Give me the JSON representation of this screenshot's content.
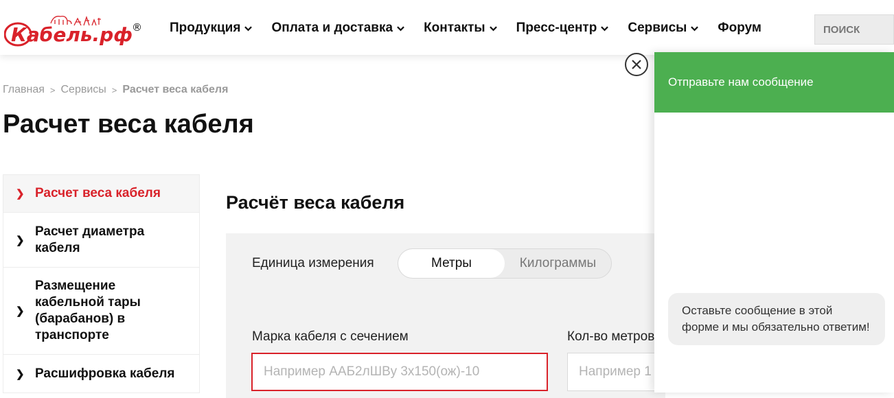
{
  "header": {
    "logo_text": "Кабель.рф",
    "logo_mark": "®",
    "nav": [
      {
        "label": "Продукция",
        "has_dropdown": true
      },
      {
        "label": "Оплата и доставка",
        "has_dropdown": true
      },
      {
        "label": "Контакты",
        "has_dropdown": true
      },
      {
        "label": "Пресс-центр",
        "has_dropdown": true
      },
      {
        "label": "Сервисы",
        "has_dropdown": true
      },
      {
        "label": "Форум",
        "has_dropdown": false
      }
    ],
    "search_placeholder": "ПОИСК"
  },
  "breadcrumb": {
    "items": [
      "Главная",
      "Сервисы"
    ],
    "separator": ">",
    "current": "Расчет веса кабеля"
  },
  "page_title": "Расчет веса кабеля",
  "sidebar": {
    "items": [
      {
        "label": "Расчет веса кабеля",
        "active": true
      },
      {
        "label": "Расчет диаметра кабеля",
        "active": false
      },
      {
        "label": "Размещение кабельной тары (барабанов) в транспорте",
        "active": false
      },
      {
        "label": "Расшифровка кабеля",
        "active": false
      }
    ]
  },
  "calculator": {
    "title": "Расчёт веса кабеля",
    "unit_label": "Единица измерения",
    "unit_options": [
      "Метры",
      "Килограммы"
    ],
    "selected_unit": "Метры",
    "brand_label": "Марка кабеля с сечением",
    "brand_placeholder": "Например ААБ2лШВу 3х150(ож)-10",
    "meters_label": "Кол-во метров",
    "meters_placeholder": "Например 1"
  },
  "chat": {
    "header": "Отправьте нам сообщение",
    "message": "Оставьте сообщение в этой форме и мы обязательно ответим!"
  },
  "colors": {
    "accent_red": "#d9222a",
    "chat_green": "#4caf50"
  },
  "icons": {
    "nav_dropdown": "chevron-down-icon",
    "sidebar_arrow": "chevron-right-icon",
    "close": "close-icon"
  }
}
